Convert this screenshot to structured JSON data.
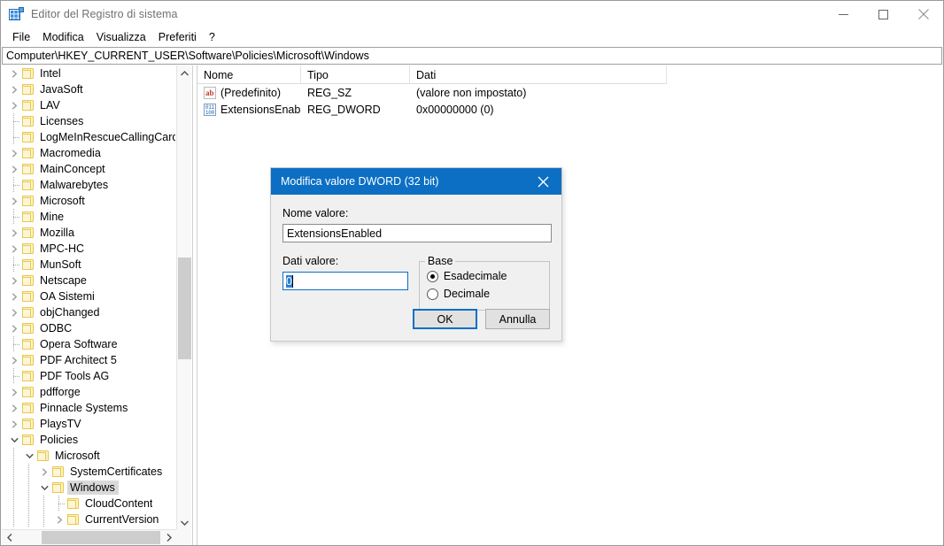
{
  "window": {
    "title": "Editor del Registro di sistema",
    "icon": "registry-icon",
    "controls": {
      "minimize": "minimize-icon",
      "maximize": "maximize-icon",
      "close": "close-icon"
    }
  },
  "menubar": {
    "items": [
      {
        "label": "File"
      },
      {
        "label": "Modifica"
      },
      {
        "label": "Visualizza"
      },
      {
        "label": "Preferiti"
      },
      {
        "label": "?"
      }
    ]
  },
  "address": {
    "value": "Computer\\HKEY_CURRENT_USER\\Software\\Policies\\Microsoft\\Windows"
  },
  "tree": {
    "items": [
      {
        "label": "Intel",
        "indent": 1,
        "state": "collapsed",
        "selected": false
      },
      {
        "label": "JavaSoft",
        "indent": 1,
        "state": "collapsed",
        "selected": false
      },
      {
        "label": "LAV",
        "indent": 1,
        "state": "collapsed",
        "selected": false
      },
      {
        "label": "Licenses",
        "indent": 1,
        "state": "leaf",
        "selected": false
      },
      {
        "label": "LogMeInRescueCallingCard",
        "indent": 1,
        "state": "leaf",
        "selected": false
      },
      {
        "label": "Macromedia",
        "indent": 1,
        "state": "collapsed",
        "selected": false
      },
      {
        "label": "MainConcept",
        "indent": 1,
        "state": "collapsed",
        "selected": false
      },
      {
        "label": "Malwarebytes",
        "indent": 1,
        "state": "leaf",
        "selected": false
      },
      {
        "label": "Microsoft",
        "indent": 1,
        "state": "collapsed",
        "selected": false
      },
      {
        "label": "Mine",
        "indent": 1,
        "state": "leaf",
        "selected": false
      },
      {
        "label": "Mozilla",
        "indent": 1,
        "state": "collapsed",
        "selected": false
      },
      {
        "label": "MPC-HC",
        "indent": 1,
        "state": "collapsed",
        "selected": false
      },
      {
        "label": "MunSoft",
        "indent": 1,
        "state": "leaf",
        "selected": false
      },
      {
        "label": "Netscape",
        "indent": 1,
        "state": "collapsed",
        "selected": false
      },
      {
        "label": "OA Sistemi",
        "indent": 1,
        "state": "collapsed",
        "selected": false
      },
      {
        "label": "objChanged",
        "indent": 1,
        "state": "collapsed",
        "selected": false
      },
      {
        "label": "ODBC",
        "indent": 1,
        "state": "collapsed",
        "selected": false
      },
      {
        "label": "Opera Software",
        "indent": 1,
        "state": "leaf",
        "selected": false
      },
      {
        "label": "PDF Architect 5",
        "indent": 1,
        "state": "collapsed",
        "selected": false
      },
      {
        "label": "PDF Tools AG",
        "indent": 1,
        "state": "leaf",
        "selected": false
      },
      {
        "label": "pdfforge",
        "indent": 1,
        "state": "collapsed",
        "selected": false
      },
      {
        "label": "Pinnacle Systems",
        "indent": 1,
        "state": "collapsed",
        "selected": false
      },
      {
        "label": "PlaysTV",
        "indent": 1,
        "state": "collapsed",
        "selected": false
      },
      {
        "label": "Policies",
        "indent": 1,
        "state": "expanded",
        "selected": false
      },
      {
        "label": "Microsoft",
        "indent": 2,
        "state": "expanded",
        "selected": false
      },
      {
        "label": "SystemCertificates",
        "indent": 3,
        "state": "collapsed",
        "selected": false
      },
      {
        "label": "Windows",
        "indent": 3,
        "state": "expanded",
        "selected": true
      },
      {
        "label": "CloudContent",
        "indent": 4,
        "state": "leaf",
        "selected": false
      },
      {
        "label": "CurrentVersion",
        "indent": 4,
        "state": "collapsed",
        "selected": false
      }
    ],
    "scrollbars": {
      "vertical_up": "scroll-up-arrow",
      "vertical_down": "scroll-down-arrow",
      "horizontal_left": "scroll-left-arrow",
      "horizontal_right": "scroll-right-arrow"
    }
  },
  "listview": {
    "columns": [
      {
        "label": "Nome"
      },
      {
        "label": "Tipo"
      },
      {
        "label": "Dati"
      }
    ],
    "rows": [
      {
        "icon": "string-value-icon",
        "name": "(Predefinito)",
        "type": "REG_SZ",
        "data": "(valore non impostato)"
      },
      {
        "icon": "dword-value-icon",
        "name": "ExtensionsEnabl...",
        "type": "REG_DWORD",
        "data": "0x00000000 (0)"
      }
    ]
  },
  "dialog": {
    "title": "Modifica valore DWORD (32 bit)",
    "close_icon": "close-icon",
    "name_label": "Nome valore:",
    "name_value": "ExtensionsEnabled",
    "data_label": "Dati valore:",
    "data_value": "0",
    "base_legend": "Base",
    "base_options": [
      {
        "label": "Esadecimale",
        "selected": true
      },
      {
        "label": "Decimale",
        "selected": false
      }
    ],
    "ok_label": "OK",
    "cancel_label": "Annulla"
  },
  "colors": {
    "accent": "#0c6fc4",
    "selection": "#d9d9d9",
    "folder": "#fdf3c8",
    "text_selection": "#2f7fd0"
  }
}
